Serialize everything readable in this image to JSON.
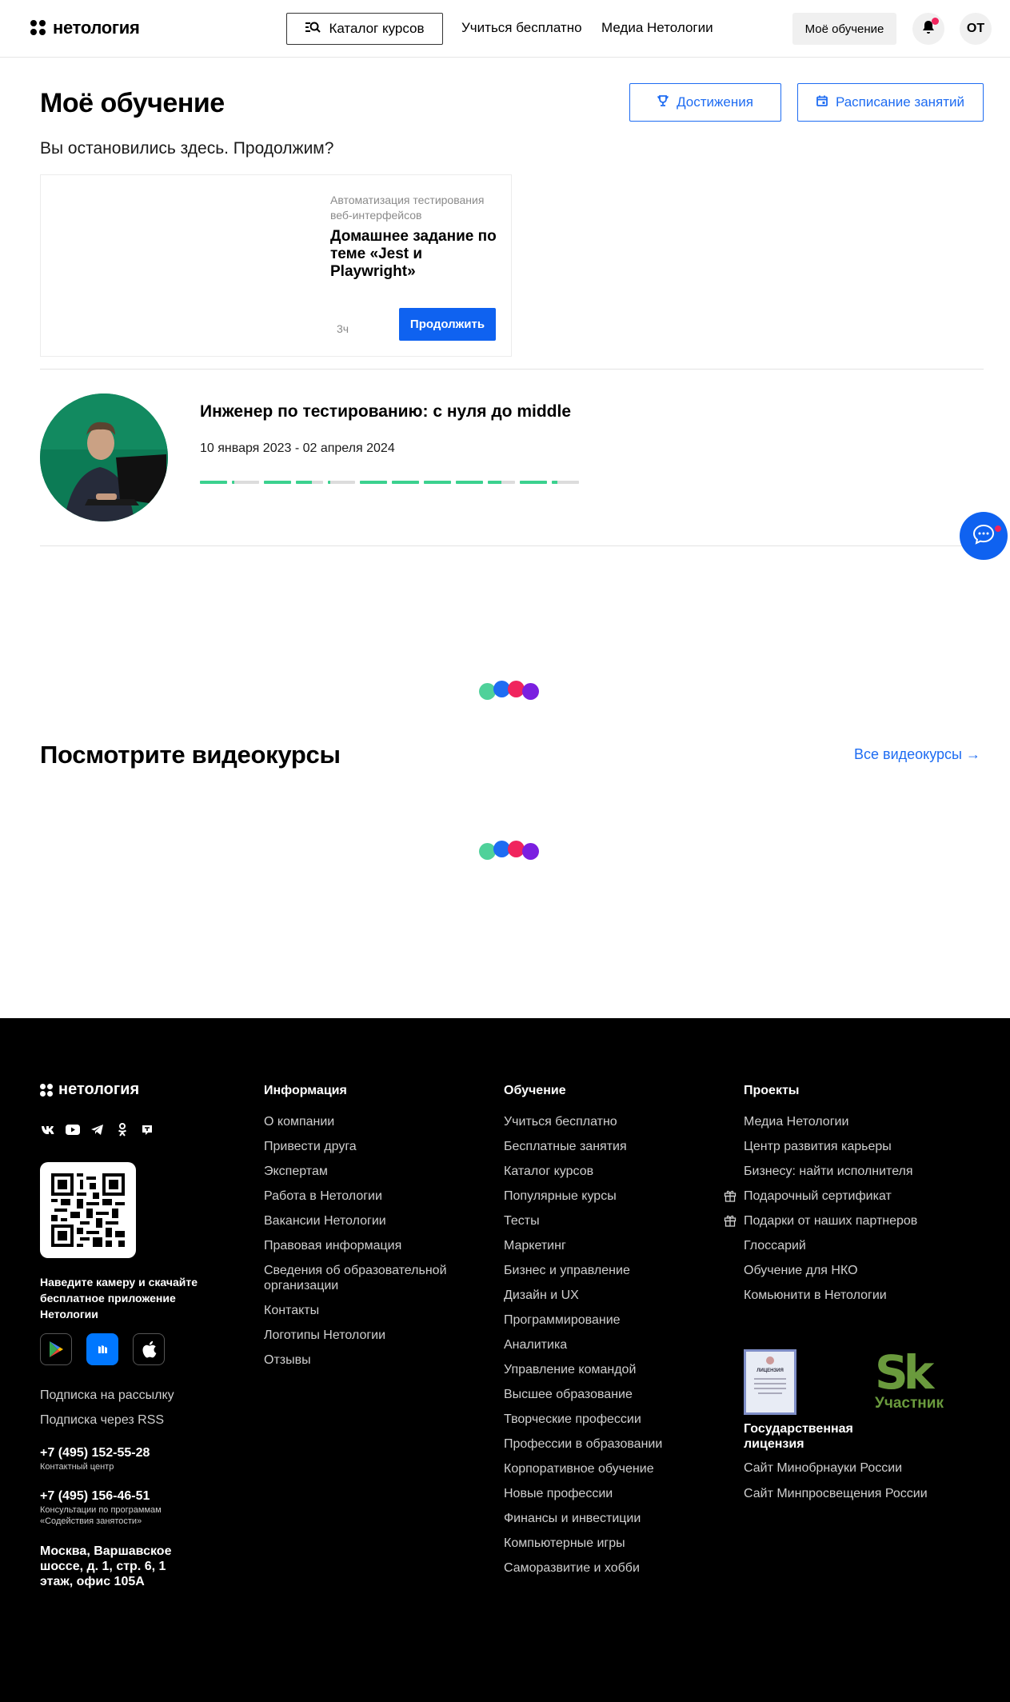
{
  "brand": {
    "name": "нетология"
  },
  "header": {
    "catalog_label": "Каталог курсов",
    "nav": [
      "Учиться бесплатно",
      "Медиа Нетологии"
    ],
    "my_learning_label": "Моё обучение",
    "avatar_initials": "ОТ"
  },
  "main": {
    "title": "Моё обучение",
    "achievements_label": "Достижения",
    "schedule_label": "Расписание занятий",
    "continue_hint": "Вы остановились здесь. Продолжим?",
    "resume_card": {
      "course": "Автоматизация тестирования веб-интерфейсов",
      "title": "Домашнее задание по теме «Jest и Playwright»",
      "time": "3ч",
      "button": "Продолжить"
    },
    "course": {
      "title": "Инженер по тестированию: с нуля до middle",
      "dates": "10 января 2023 - 02 апреля 2024",
      "progress_segments": [
        1,
        0.1,
        1,
        0.6,
        0.1,
        1,
        1,
        1,
        1,
        0.5,
        1,
        0.2
      ]
    },
    "videos_title": "Посмотрите видеокурсы",
    "all_videos_label": "Все видеокурсы →"
  },
  "colors": {
    "accent": "#1e6cf2",
    "button": "#0f62f0",
    "progress": "#3bd18f",
    "loader": [
      "#4fd19a",
      "#1e6cf2",
      "#f0245d",
      "#7b1fe0"
    ],
    "footer_bg": "#000000"
  },
  "icons": {
    "catalog": "search-list-icon",
    "achievements": "trophy-icon",
    "schedule": "calendar-icon",
    "notifications": "bell-icon",
    "chat": "chat-bubble-icon"
  },
  "footer": {
    "socials": [
      "vk-icon",
      "youtube-icon",
      "telegram-icon",
      "odnoklassniki-icon",
      "tenchat-icon"
    ],
    "qr_text": "Наведите камеру и скачайте бесплатное приложение Нетологии",
    "stores": [
      "google-play-icon",
      "rustore-icon",
      "apple-icon"
    ],
    "subscribe_newsletter": "Подписка на рассылку",
    "subscribe_rss": "Подписка через RSS",
    "phone1": "+7 (495) 152-55-28",
    "phone1_note": "Контактный центр",
    "phone2": "+7 (495) 156-46-51",
    "phone2_note": "Консультации по программам «Содействия занятости»",
    "address": "Москва, Варшавское шоссе, д. 1, стр. 6, 1 этаж, офис 105А",
    "info_title": "Информация",
    "info_links": [
      "О компании",
      "Привести друга",
      "Экспертам",
      "Работа в Нетологии",
      "Вакансии Нетологии",
      "Правовая информация",
      "Сведения об образовательной организации",
      "Контакты",
      "Логотипы Нетологии",
      "Отзывы"
    ],
    "edu_title": "Обучение",
    "edu_links": [
      "Учиться бесплатно",
      "Бесплатные занятия",
      "Каталог курсов",
      "Популярные курсы",
      "Тесты",
      "Маркетинг",
      "Бизнес и управление",
      "Дизайн и UX",
      "Программирование",
      "Аналитика",
      "Управление командой",
      "Высшее образование",
      "Творческие профессии",
      "Профессии в образовании",
      "Корпоративное обучение",
      "Новые профессии",
      "Финансы и инвестиции",
      "Компьютерные игры",
      "Саморазвитие и хобби"
    ],
    "projects_title": "Проекты",
    "projects_links": [
      "Медиа Нетологии",
      "Центр развития карьеры",
      "Бизнесу: найти исполнителя",
      "Подарочный сертификат",
      "Подарки от наших партнеров",
      "Глоссарий",
      "Обучение для НКО",
      "Комьюнити в Нетологии"
    ],
    "license_doc_text": "ЛИЦЕНЗИЯ",
    "license_label": "Государственная лицензия",
    "sk_logo": "Sk",
    "sk_label": "Участник",
    "ministry_links": [
      "Сайт Минобрнауки России",
      "Сайт Минпросвещения России"
    ]
  }
}
